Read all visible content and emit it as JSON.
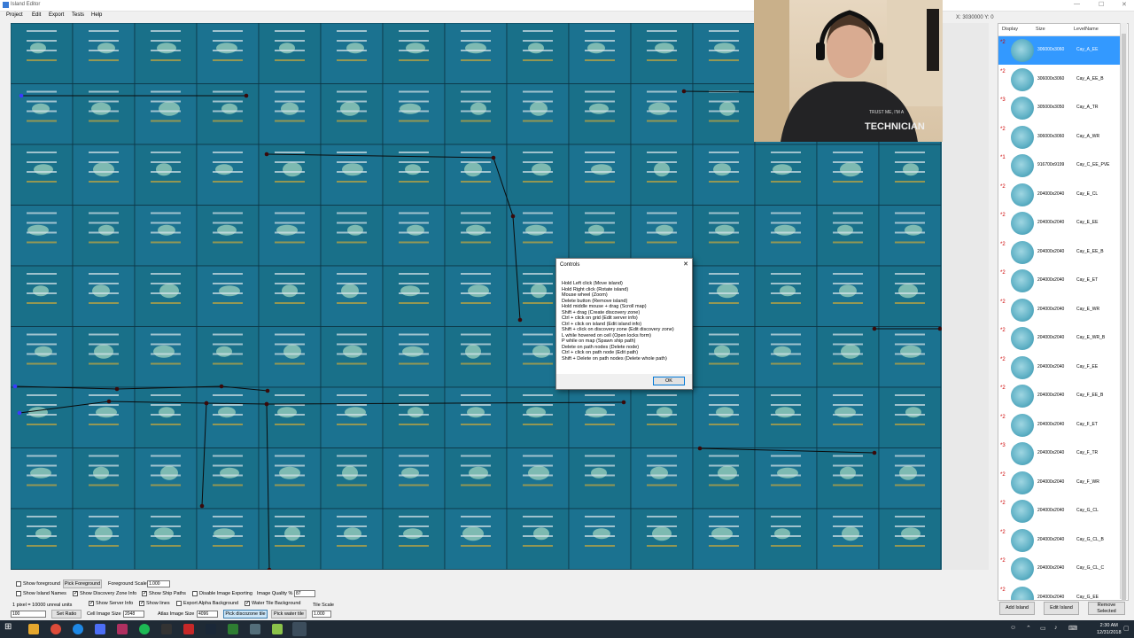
{
  "window": {
    "title": "Island Editor",
    "min": "—",
    "max": "☐",
    "close": "✕"
  },
  "menu": [
    "Project",
    "Edit",
    "Export",
    "Tests",
    "Help"
  ],
  "coord_readout": "X: 3030000 Y: 0",
  "list": {
    "headers": {
      "display": "Display",
      "size": "Size",
      "level": "LevelName"
    },
    "rows": [
      {
        "prio": "*2",
        "size": "306000x3060",
        "level": "Cay_A_EE"
      },
      {
        "prio": "*2",
        "size": "306000x3060",
        "level": "Cay_A_EE_B"
      },
      {
        "prio": "*3",
        "size": "305000x3050",
        "level": "Cay_A_TR"
      },
      {
        "prio": "*2",
        "size": "306000x3060",
        "level": "Cay_A_WR"
      },
      {
        "prio": "*1",
        "size": "916700x9199",
        "level": "Cay_C_EE_PVE"
      },
      {
        "prio": "*2",
        "size": "204000x2040",
        "level": "Cay_E_CL"
      },
      {
        "prio": "*2",
        "size": "204000x2040",
        "level": "Cay_E_EE"
      },
      {
        "prio": "*2",
        "size": "204000x2040",
        "level": "Cay_E_EE_B"
      },
      {
        "prio": "*2",
        "size": "204000x2040",
        "level": "Cay_E_ET"
      },
      {
        "prio": "*2",
        "size": "204000x2040",
        "level": "Cay_E_WR"
      },
      {
        "prio": "*2",
        "size": "204000x2040",
        "level": "Cay_E_WR_B"
      },
      {
        "prio": "*2",
        "size": "204000x2040",
        "level": "Cay_F_EE"
      },
      {
        "prio": "*2",
        "size": "204000x2040",
        "level": "Cay_F_EE_B"
      },
      {
        "prio": "*2",
        "size": "204000x2040",
        "level": "Cay_F_ET"
      },
      {
        "prio": "*3",
        "size": "204000x2040",
        "level": "Cay_F_TR"
      },
      {
        "prio": "*2",
        "size": "204000x2040",
        "level": "Cay_F_WR"
      },
      {
        "prio": "*2",
        "size": "204000x2040",
        "level": "Cay_G_CL"
      },
      {
        "prio": "*2",
        "size": "204000x2040",
        "level": "Cay_G_CL_B"
      },
      {
        "prio": "*2",
        "size": "204000x2040",
        "level": "Cay_G_CL_C"
      },
      {
        "prio": "*2",
        "size": "204000x2040",
        "level": "Cay_G_EE"
      }
    ]
  },
  "list_buttons": {
    "add": "Add Island",
    "edit": "Edit Island",
    "remove": "Remove Selected"
  },
  "controls_panel": {
    "show_foreground": "Show foreground",
    "pick_foreground": "Pick Foreground",
    "foreground_scale_label": "Foreground Scale",
    "foreground_scale_value": "1.000",
    "show_island_names": "Show Island Names",
    "show_discovery_zone_info": "Show Discovery Zone Info",
    "show_ship_paths": "Show Ship Paths",
    "disable_image_exporting": "Disable Image Exporting",
    "image_quality_label": "Image Quality %",
    "image_quality_value": "87",
    "show_server_info": "Show Server Info",
    "show_lines": "Show lines",
    "export_alpha_background": "Export Alpha Background",
    "water_tile_background": "Water Tile Background",
    "tile_scale_label": "Tile Scale",
    "tile_scale_value": "1.000",
    "pixel_ratio": "1 pixel = 10000 unreal units",
    "ratio_value": "100",
    "set_ratio": "Set Ratio",
    "cell_image_size_label": "Cell Image Size",
    "cell_image_size_value": "2048",
    "atlas_image_size_label": "Atlas Image Size",
    "atlas_image_size_value": "4096",
    "pick_discozone_tile": "Pick discozone tile",
    "pick_water_tile": "Pick water tile"
  },
  "dialog": {
    "title": "Controls",
    "lines": [
      "Hold Left click (Move island)",
      "Hold Right click (Rotate island)",
      "Mouse wheel (Zoom)",
      "Delete button (Remove island)",
      "Hold middle mouse + drag (Scroll map)",
      "Shift + drag (Create discovery zone)",
      "Ctrl + click on grid (Edit server info)",
      "Ctrl + click on island (Edit island info)",
      "Shift + click on discovery zone (Edit discovery zone)",
      "L while hovered on cell (Open locks form)",
      "P while on map (Spawn ship path)",
      "Delete on path nodes (Delete node)",
      "Ctrl + click on path node (Edit path)",
      "Shift + Delete on path nodes (Delete whole path)"
    ],
    "ok": "OK"
  },
  "webcam_shirt_text": "TRUST ME, I'M A TECHNICIAN",
  "tray": {
    "time": "2:30 AM",
    "date": "12/31/2018"
  },
  "colors": {
    "map_bg": "#1a6e8a",
    "grid_line": "#0d3645",
    "selection": "#3399ff",
    "node": "#3a0a0a"
  }
}
